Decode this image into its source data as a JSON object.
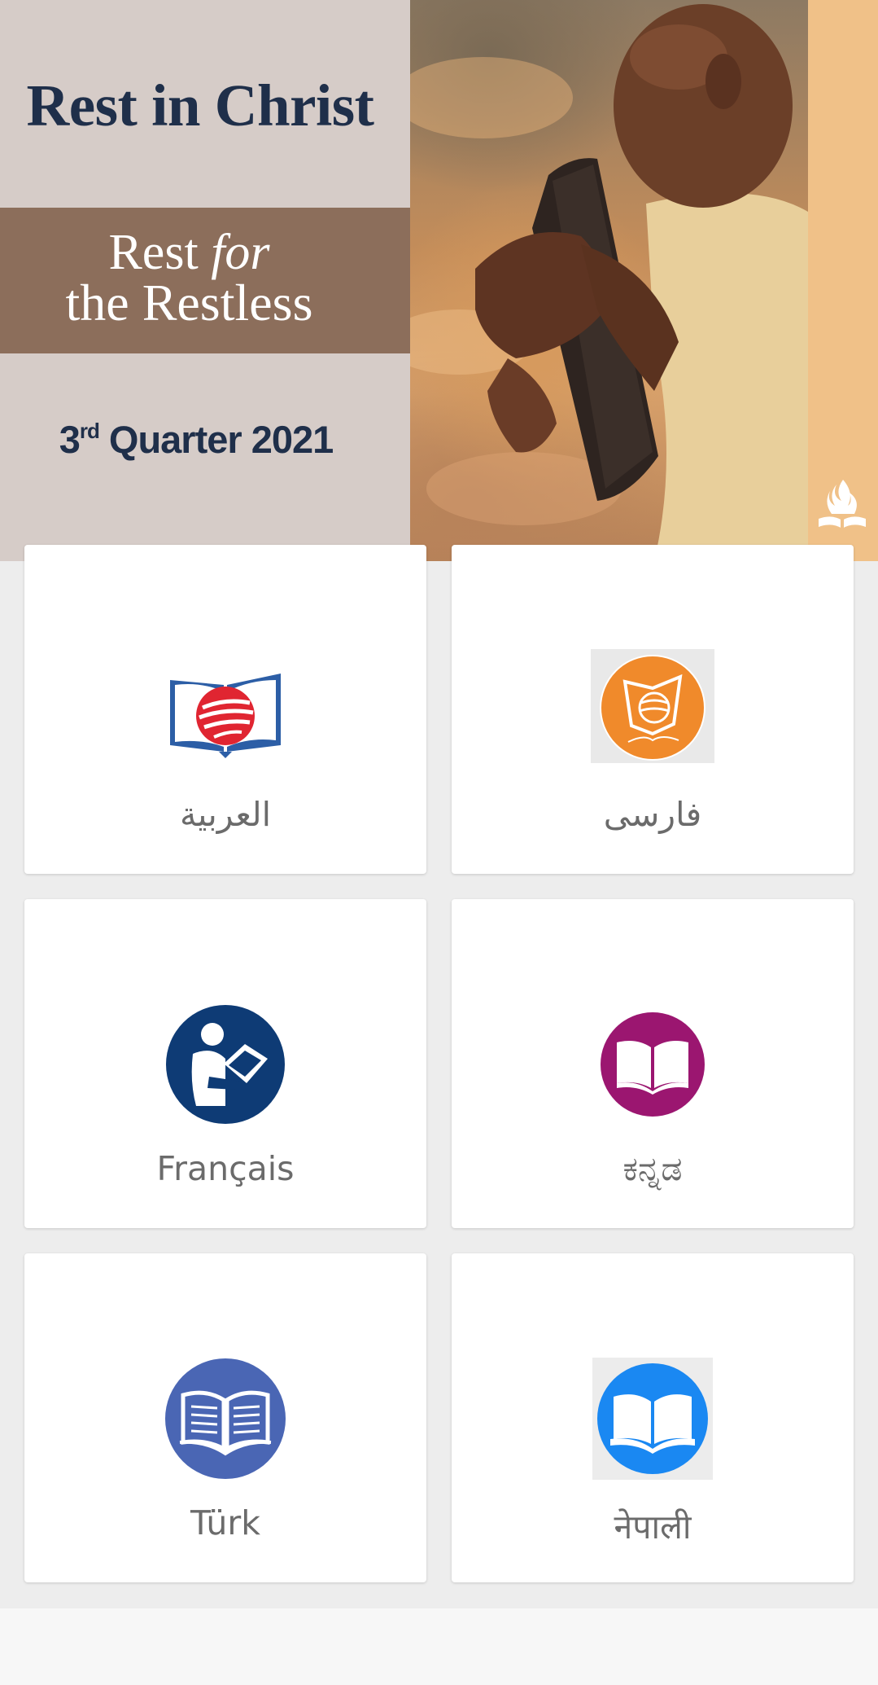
{
  "banner": {
    "title": "Rest in Christ",
    "subtitle_line1_a": "Rest ",
    "subtitle_line1_b": "for",
    "subtitle_line2": "the Restless",
    "quarter_num": "3",
    "quarter_suffix": "rd",
    "quarter_text": " Quarter 2021",
    "colors": {
      "title": "#1f2f4a",
      "band": "#8c6e5b",
      "stripe": "#f0c188"
    }
  },
  "languages": [
    {
      "label": "العربية",
      "icon": "open-book-red-globe-icon",
      "color": "#2c5ea6"
    },
    {
      "label": "فارسی",
      "icon": "orange-book-globe-icon",
      "color": "#f08a2b"
    },
    {
      "label": "Français",
      "icon": "person-reading-icon",
      "color": "#0e3b75"
    },
    {
      "label": "ಕನ್ನಡ",
      "icon": "open-book-magenta-icon",
      "color": "#9b1670"
    },
    {
      "label": "Türk",
      "icon": "open-book-lined-icon",
      "color": "#4a66b4"
    },
    {
      "label": "नेपाली",
      "icon": "open-book-blue-icon",
      "color": "#1a88f2"
    }
  ]
}
